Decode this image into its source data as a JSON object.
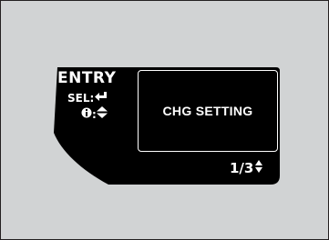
{
  "display": {
    "title": "ENTRY",
    "select_hint": "SEL:",
    "info_hint": ":",
    "screen_label": "CHG SETTING",
    "page_indicator": "1/3"
  },
  "icons": {
    "select": "enter-arrow-icon",
    "info": "info-circle-icon",
    "info_scroll": "up-down-triangles-icon",
    "page_scroll": "up-down-triangles-icon"
  },
  "colors": {
    "background": "#d1d3d4",
    "panel": "#000000",
    "text": "#ffffff"
  }
}
